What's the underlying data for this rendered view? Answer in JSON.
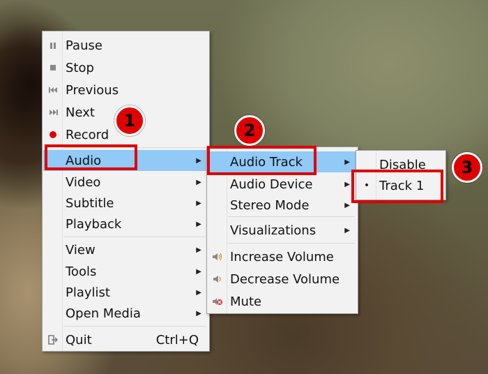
{
  "main_menu": {
    "items": [
      {
        "label": "Pause"
      },
      {
        "label": "Stop"
      },
      {
        "label": "Previous"
      },
      {
        "label": "Next"
      },
      {
        "label": "Record"
      },
      {
        "label": "Audio"
      },
      {
        "label": "Video"
      },
      {
        "label": "Subtitle"
      },
      {
        "label": "Playback"
      },
      {
        "label": "View"
      },
      {
        "label": "Tools"
      },
      {
        "label": "Playlist"
      },
      {
        "label": "Open Media"
      },
      {
        "label": "Quit",
        "shortcut": "Ctrl+Q"
      }
    ]
  },
  "audio_menu": {
    "items": [
      {
        "label": "Audio Track"
      },
      {
        "label": "Audio Device"
      },
      {
        "label": "Stereo Mode"
      },
      {
        "label": "Visualizations"
      },
      {
        "label": "Increase Volume"
      },
      {
        "label": "Decrease Volume"
      },
      {
        "label": "Mute"
      }
    ]
  },
  "track_menu": {
    "items": [
      {
        "label": "Disable"
      },
      {
        "label": "Track 1",
        "checked": true
      }
    ]
  },
  "callouts": [
    "1",
    "2",
    "3"
  ],
  "colors": {
    "highlight": "#91c9f7",
    "callout_red": "#e00000",
    "menu_bg": "#f2f2f2"
  }
}
